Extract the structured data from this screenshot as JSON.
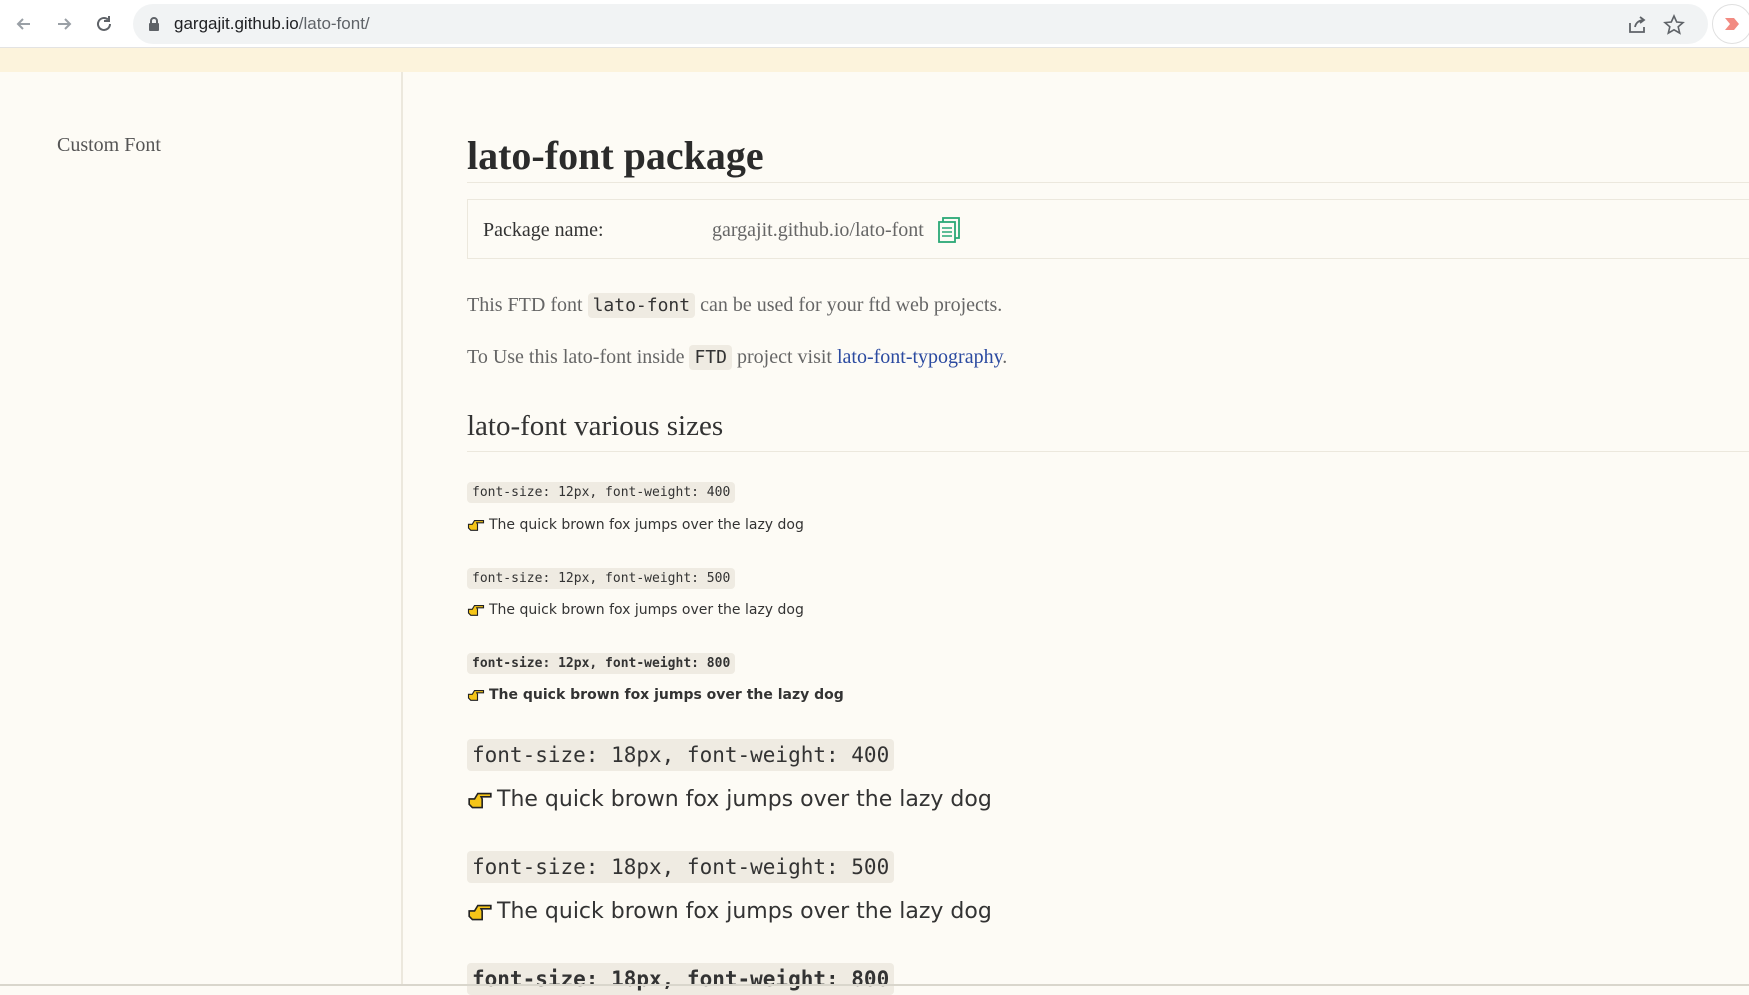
{
  "browser": {
    "url_host": "gargajit.github.io",
    "url_path": "/lato-font/"
  },
  "sidebar": {
    "title": "Custom Font"
  },
  "main": {
    "title": "lato-font package",
    "package": {
      "label": "Package name:",
      "value": "gargajit.github.io/lato-font"
    },
    "para1": {
      "before": "This FTD font ",
      "code": "lato-font",
      "after": " can be used for your ftd web projects."
    },
    "para2": {
      "before": "To Use this lato-font inside ",
      "code": "FTD",
      "middle": " project visit ",
      "link": "lato-font-typography",
      "after": "."
    },
    "sizes_heading": "lato-font various sizes",
    "samples": [
      {
        "spec": "font-size: 12px, font-weight: 400",
        "text": "The quick brown fox jumps over the lazy dog"
      },
      {
        "spec": "font-size: 12px, font-weight: 500",
        "text": "The quick brown fox jumps over the lazy dog"
      },
      {
        "spec": "font-size: 12px, font-weight: 800",
        "text": "The quick brown fox jumps over the lazy dog"
      },
      {
        "spec": "font-size: 18px, font-weight: 400",
        "text": "The quick brown fox jumps over the lazy dog"
      },
      {
        "spec": "font-size: 18px, font-weight: 500",
        "text": "The quick brown fox jumps over the lazy dog"
      },
      {
        "spec": "font-size: 18px, font-weight: 800",
        "text": ""
      }
    ]
  },
  "colors": {
    "page_bg": "#fdfbf5",
    "banner": "#fcf3dc",
    "link": "#2b4aa0",
    "copy_icon": "#2aa876",
    "hand_fill": "#f5c518"
  }
}
